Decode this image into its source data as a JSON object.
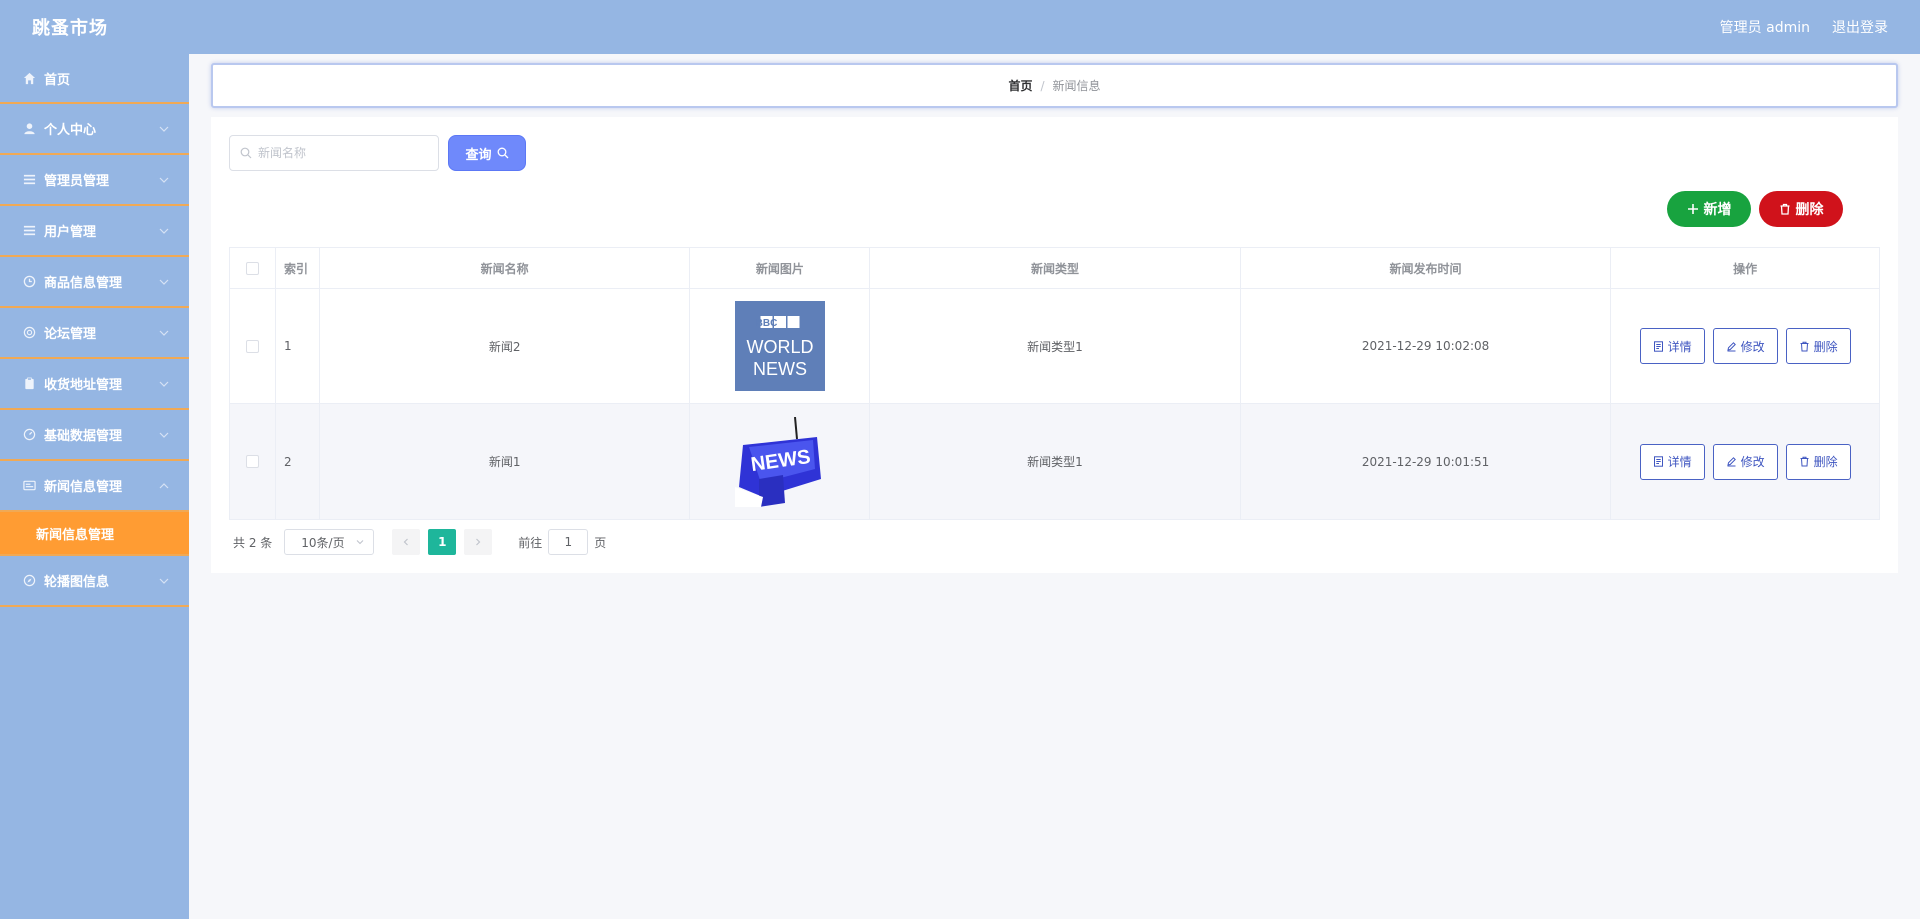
{
  "app": {
    "title": "跳蚤市场"
  },
  "header": {
    "user_label": "管理员 admin",
    "logout_label": "退出登录"
  },
  "sidebar": {
    "items": [
      {
        "label": "首页",
        "icon": "home-icon"
      },
      {
        "label": "个人中心",
        "icon": "user-icon"
      },
      {
        "label": "管理员管理",
        "icon": "list-icon"
      },
      {
        "label": "用户管理",
        "icon": "list-icon"
      },
      {
        "label": "商品信息管理",
        "icon": "clock-icon"
      },
      {
        "label": "论坛管理",
        "icon": "globe-icon"
      },
      {
        "label": "收货地址管理",
        "icon": "clipboard-icon"
      },
      {
        "label": "基础数据管理",
        "icon": "gauge-icon"
      },
      {
        "label": "新闻信息管理",
        "icon": "news-icon"
      },
      {
        "label": "轮播图信息",
        "icon": "compass-icon"
      }
    ],
    "active_sub": "新闻信息管理"
  },
  "breadcrumb": {
    "home": "首页",
    "separator": "/",
    "current": "新闻信息"
  },
  "search": {
    "placeholder": "新闻名称",
    "query_label": "查询"
  },
  "actions": {
    "add_label": "新增",
    "delete_label": "删除"
  },
  "table": {
    "headers": [
      "索引",
      "新闻名称",
      "新闻图片",
      "新闻类型",
      "新闻发布时间",
      "操作"
    ],
    "rows": [
      {
        "index": "1",
        "name": "新闻2",
        "image_text": [
          "BBC",
          "WORLD",
          "NEWS"
        ],
        "type": "新闻类型1",
        "time": "2021-12-29 10:02:08"
      },
      {
        "index": "2",
        "name": "新闻1",
        "image_text": [
          "NEWS"
        ],
        "type": "新闻类型1",
        "time": "2021-12-29 10:01:51"
      }
    ],
    "op_labels": {
      "detail": "详情",
      "edit": "修改",
      "delete": "删除"
    }
  },
  "pagination": {
    "total": "共 2 条",
    "page_size": "10条/页",
    "current_page": "1",
    "goto_prefix": "前往",
    "goto_value": "1",
    "goto_suffix": "页"
  },
  "colors": {
    "header_bg": "#95b6e3",
    "active_menu": "#ff9c33",
    "query_btn": "#6f89fb",
    "add_btn": "#18a33f",
    "delete_btn": "#d0121b",
    "page_active": "#1eb69b"
  }
}
